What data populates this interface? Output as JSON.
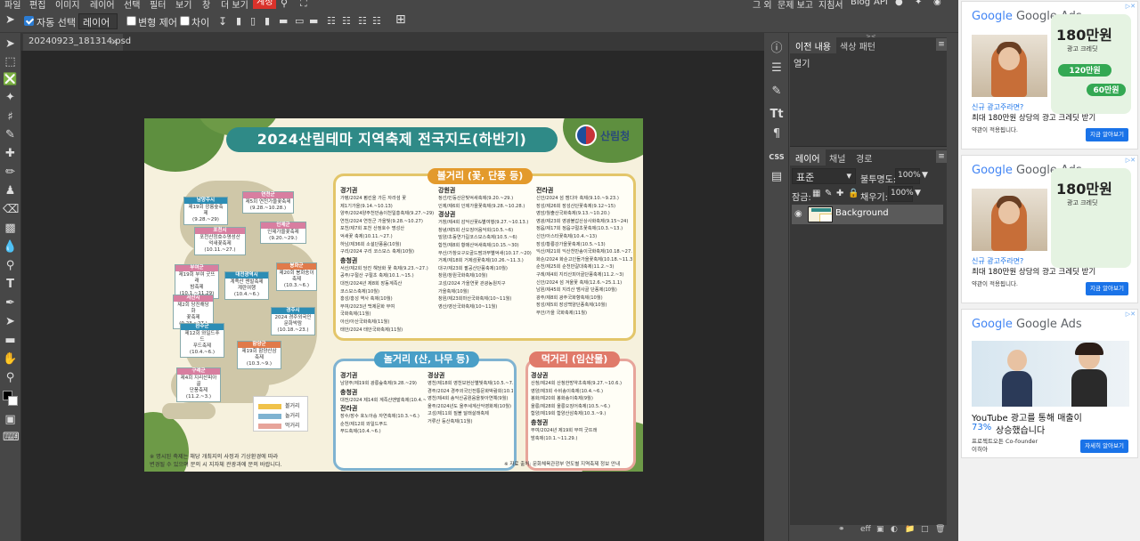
{
  "menu": {
    "items": [
      "파일",
      "편집",
      "이미지",
      "레이어",
      "선택",
      "필터",
      "보기",
      "창",
      "더 보기",
      "계정"
    ],
    "right": [
      "그 외",
      "문제 보고",
      "지침서",
      "Blog",
      "API"
    ]
  },
  "options": {
    "auto_select": "자동 선택",
    "layer_select": "레이어",
    "transform": "변형 제어",
    "distance": "차이"
  },
  "doc_tab": {
    "name": "20240923_181314.psd"
  },
  "artwork": {
    "title": "2024산림테마 지역축제 전국지도(하반기)",
    "agency": "산림청",
    "play": {
      "title": "볼거리 (꽃, 단풍 등)",
      "col1": {
        "r1": "경기권",
        "r1_items": [
          "가평/2024 펌킨을 가든 자라섬 꽃",
          "제1기가을(9.14.~10.13)",
          "양주/2024양주천만송이천일홍축제(9.27.~29)",
          "연천/2024 연천군 가을빛(9.28.~10.27)",
          "포천/제7회 포천 산정호수 명성산",
          "억새꽃 축제(10.11.~27.)",
          "하남/제36회 소설단풍음(10월)",
          "구리/2024 구리 코스모스 축제(10월)"
        ],
        "r2": "충청권",
        "r2_items": [
          "서산/제2회 당진 해당화 꽃 축제(9.23.~27.)",
          "공주/구절산 구절초 축제(10.1.~15.)",
          "대전/2024년 제8회 장동계족산",
          "코스모스축제(10월)",
          "홍성/홍성 역사 축제(10월)",
          "부여/2023년 백제문화 부여",
          "국화축제(11월)",
          "아산/아산국화축제(11월)",
          "태안/2024 태안국화축제(11월)"
        ]
      },
      "col2": {
        "r1": "강원권",
        "r1_items": [
          "정선/민둥산은빛억새축제(9.20.~29.)",
          "인제/제6회 인제가을꽃축제(9.28.~10.28.)"
        ],
        "r2": "경상권",
        "r2_items": [
          "거창/제4회 감악산꽃&별여행(9.27.~10.13.)",
          "창녕/제5회 산오징어음악회(10.5.~6)",
          "밀양/초동연가길코스모스축제(10.5.~6)",
          "합천/제8회 황매산억새축제(10.15.~30)",
          "부산/가창오구오골드팜과부별억새(10.17.~20)",
          "거제/제18회 거제섬꽃축제(10.26.~11.3.)",
          "대구/제23회 팔공산단풍축제(10월)",
          "창원/창원국화축제(10월)",
          "고성/2024 가을연꽃 관광농원지구",
          "가을축제(10월)",
          "창원/제23회마산국화축제(10~11월)",
          "영산/영산국화축제(10~11월)"
        ]
      },
      "col3": {
        "r1": "전라권",
        "r1_items": [
          "신안/2024 섬 캠디아 축제(9.10.~9.23.)",
          "장성/제26회 장성산단꽃축제(9.12~15)",
          "영암/월출산국화축제(9.13.~10.20.)",
          "영광/제23회 영광불갑산상사화축제(9.15~24)",
          "정읍/제17회 정읍구절초꽃축제(10.3.~13.)",
          "신안/아스타꽃축제(10.4.~13)",
          "장성/황룡강가을꽃축제(10.5.~13)",
          "익산/제21회 익산천만송이국화축제(10.18.~27.)",
          "화순/2024 화순고인돌가을꽃축제(10.18.~11.3)",
          "순천/제25회 순천만갈대축제(11.2.~3)",
          "구례/제4회 지리산피아골단풍축제(11.2.~3)",
          "신안/2024 섬 겨울꽃 축제(12.6.~25.1.1)",
          "남원/제45회 지리산 뱀사골 단풍제(10월)",
          "광주/제8회 광주국화향축제(10월)",
          "장성/제5회 장성백양단풍축제(10월)",
          "부안/가을 국화축제(11월)"
        ]
      }
    },
    "forest": {
      "title": "놀거리 (산, 나무 등)",
      "col1": {
        "r1": "경기권",
        "r1_items": [
          "남양주/제19회 광릉숲축제(9.28.~29)"
        ],
        "r2": "충청권",
        "r2_items": [
          "대전/2024 제14회 계족산맨발축제(10.4.~6.)"
        ],
        "r3": "전라권",
        "r3_items": [
          "장수/장수 호노아승 자연축제(10.3.~6.)",
          "순천/제12회 와일드푸드",
          "푸드축제(10.4.~6.)"
        ]
      },
      "col2": {
        "r1": "경상권",
        "r1_items": [
          "영천/제18회 영천보현산별빛축제(10.5.~7.)",
          "경주/2024 경주외국인전통문화박람회(10.12.~22)",
          "영천/제4회 송악산공원음을찾아연예(9월)",
          "울주/2024년도 울주세계산악영화제(10월)",
          "고성/제11회 질볼 달래살래축제",
          "거류산 등산축제(11월)"
        ]
      }
    },
    "food": {
      "title": "먹거리 (임산물)",
      "col1": {
        "r1": "경상권",
        "r1_items": [
          "산청/제24회 산청한방약초축제(9.27.~10.6.)",
          "영양/제3회 수비송이축제(10.4.~6.)",
          "봉화/제20회 봉화송이축제(9월)",
          "울릉/제28회 울릉오징어축제(10.5.~6.)",
          "함양/제19회 함양산삼축제(10.3.~9.)"
        ],
        "r2": "충청권",
        "r2_items": [
          "부여/2024년 제19회 부여 굿뜨래",
          "밤축제(10.1.~11.29.)"
        ]
      }
    },
    "map_tags": [
      {
        "head": "남양주시",
        "body": "제19회 광릉숲축제\n(9.28.~29)"
      },
      {
        "head": "연천군",
        "body": "제5회 연천가을꽃축제\n(9.28.~10.28.)"
      },
      {
        "head": "포천시",
        "body": "포천산정호수명성산\n억새꽃축제(10.11.~27.)"
      },
      {
        "head": "인제군",
        "body": "인제가을꽃축제\n(9.20.~29.)"
      },
      {
        "head": "부여군",
        "body": "제19회 부여 굿뜨래\n밤축제(10.1.~11.29)"
      },
      {
        "head": "대전광역시",
        "body": "계족산 맨발축제\n계란여행(10.4.~6.)"
      },
      {
        "head": "봉화군",
        "body": "제20회 봉화송이축제\n(10.3.~6.)"
      },
      {
        "head": "서산시",
        "body": "제2회 당진해당화\n꽃축제(9.23.~27.)"
      },
      {
        "head": "경주시",
        "body": "2024 경주외국인문화박람\n(10.18.~23.)"
      },
      {
        "head": "완주군",
        "body": "제12회 와일드푸드\n푸드축제(10.4.~6.)"
      },
      {
        "head": "함양군",
        "body": "제19회 함양산삼축제\n(10.3.~9.)"
      },
      {
        "head": "구례군",
        "body": "제4회 지리산피아골\n단풍축제(11.2.~3.)"
      }
    ],
    "legend": [
      "볼거리",
      "놀거리",
      "먹거리"
    ],
    "note_left": "※ 명시된 축제는 해당 개최지의 사정과 기상환경에 따라\n변경될 수 있으며 문의 시 지자체 관광과에 문의 바랍니다.",
    "note_right": "※ 자료 출처: 문화체육관광부 연도별 지역축제 정보 안내"
  },
  "panels": {
    "history_tabs": [
      "이전 내용",
      "색상 패턴"
    ],
    "history_item": "열기",
    "layer_tabs": [
      "레이어",
      "채널",
      "경로"
    ],
    "blend_mode": "표준",
    "opacity_label": "불투명도:",
    "opacity_value": "100%",
    "lock_label": "잠금:",
    "fill_label": "채우기:",
    "fill_value": "100%",
    "layer_name": "Background",
    "css_label": "CSS"
  },
  "ads": [
    {
      "brand": "Google Ads",
      "big": "180만원",
      "small": "광고 크레딧",
      "p1": "120만원",
      "p2": "60만원",
      "line1": "신규 광고주라면?",
      "line2": "최대 180만원 상당의 광고 크레딧 받기",
      "line3": "약관이 적용됩니다.",
      "cta": "지금 알아보기"
    },
    {
      "brand": "Google Ads",
      "big": "180만원",
      "small": "광고 크레딧",
      "line1": "신규 광고주라면?",
      "line2": "최대 180만원 상당의 광고 크레딧 받기",
      "line3": "약관이 적용됩니다.",
      "cta": "지금 알아보기"
    },
    {
      "brand": "Google Ads",
      "line1": "YouTube 광고를 통해 매출이",
      "line2a": "73%",
      "line2b": "상승했습니다",
      "line3": "프로젝트오튼 Co-founder",
      "line4": "이히아",
      "cta": "자세히 알아보기"
    }
  ],
  "colors": {
    "accent": "#d9322b",
    "teal": "#2f8a87",
    "panel_bg": "#474747",
    "canvas_bg": "#282828"
  }
}
